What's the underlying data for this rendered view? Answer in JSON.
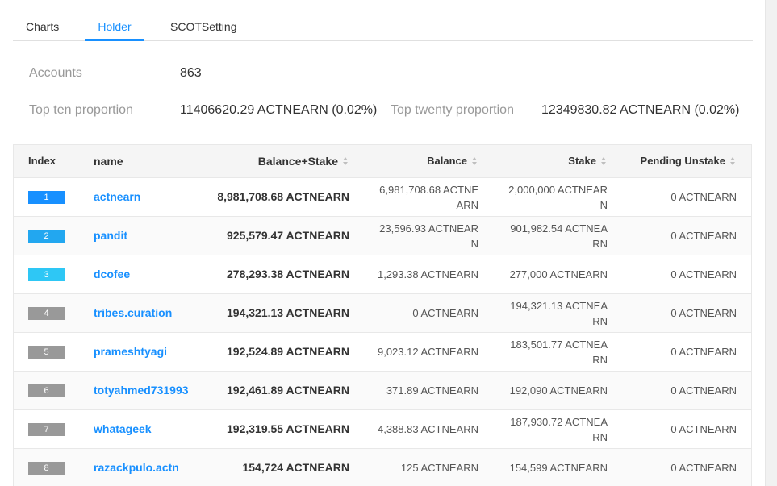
{
  "tabs": [
    "Charts",
    "Holder",
    "SCOTSetting"
  ],
  "info": {
    "accounts_label": "Accounts",
    "accounts_value": "863",
    "top_ten_label": "Top ten proportion",
    "top_ten_value": "11406620.29 ACTNEARN (0.02%)",
    "top_twenty_label": "Top twenty proportion",
    "top_twenty_value": "12349830.82 ACTNEARN (0.02%)"
  },
  "table": {
    "headers": {
      "index": "Index",
      "name": "name",
      "balance_stake": "Balance+Stake",
      "balance": "Balance",
      "stake": "Stake",
      "pending": "Pending Unstake"
    },
    "rows": [
      {
        "index": "1",
        "name": "actnearn",
        "balance_stake": "8,981,708.68 ACTNEARN",
        "balance_l1": "6,981,708.68 ACTNE",
        "balance_l2": "ARN",
        "stake_l1": "2,000,000 ACTNEAR",
        "stake_l2": "N",
        "pending": "0 ACTNEARN",
        "badge_color": "#1890ff"
      },
      {
        "index": "2",
        "name": "pandit",
        "balance_stake": "925,579.47 ACTNEARN",
        "balance_l1": "23,596.93 ACTNEAR",
        "balance_l2": "N",
        "stake_l1": "901,982.54 ACTNEA",
        "stake_l2": "RN",
        "pending": "0 ACTNEARN",
        "badge_color": "#22a7f0"
      },
      {
        "index": "3",
        "name": "dcofee",
        "balance_stake": "278,293.38 ACTNEARN",
        "balance_l1": "1,293.38 ACTNEARN",
        "balance_l2": "",
        "stake_l1": "277,000 ACTNEARN",
        "stake_l2": "",
        "pending": "0 ACTNEARN",
        "badge_color": "#2ec7f5"
      },
      {
        "index": "4",
        "name": "tribes.curation",
        "balance_stake": "194,321.13 ACTNEARN",
        "balance_l1": "0 ACTNEARN",
        "balance_l2": "",
        "stake_l1": "194,321.13 ACTNEA",
        "stake_l2": "RN",
        "pending": "0 ACTNEARN",
        "badge_color": "#999999"
      },
      {
        "index": "5",
        "name": "prameshtyagi",
        "balance_stake": "192,524.89 ACTNEARN",
        "balance_l1": "9,023.12 ACTNEARN",
        "balance_l2": "",
        "stake_l1": "183,501.77 ACTNEA",
        "stake_l2": "RN",
        "pending": "0 ACTNEARN",
        "badge_color": "#999999"
      },
      {
        "index": "6",
        "name": "totyahmed731993",
        "balance_stake": "192,461.89 ACTNEARN",
        "balance_l1": "371.89 ACTNEARN",
        "balance_l2": "",
        "stake_l1": "192,090 ACTNEARN",
        "stake_l2": "",
        "pending": "0 ACTNEARN",
        "badge_color": "#999999"
      },
      {
        "index": "7",
        "name": "whatageek",
        "balance_stake": "192,319.55 ACTNEARN",
        "balance_l1": "4,388.83 ACTNEARN",
        "balance_l2": "",
        "stake_l1": "187,930.72 ACTNEA",
        "stake_l2": "RN",
        "pending": "0 ACTNEARN",
        "badge_color": "#999999"
      },
      {
        "index": "8",
        "name": "razackpulo.actn",
        "balance_stake": "154,724 ACTNEARN",
        "balance_l1": "125 ACTNEARN",
        "balance_l2": "",
        "stake_l1": "154,599 ACTNEARN",
        "stake_l2": "",
        "pending": "0 ACTNEARN",
        "badge_color": "#999999"
      }
    ]
  },
  "colors": {
    "accent": "#1890ff",
    "header_bg": "#f5f5f5",
    "label": "#999999"
  }
}
